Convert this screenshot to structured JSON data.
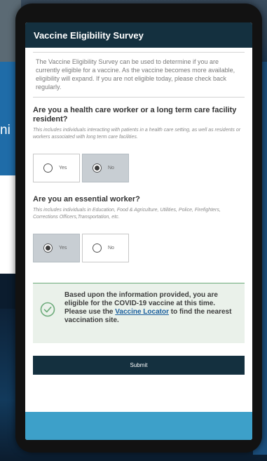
{
  "background": {
    "partial_text": "ni"
  },
  "survey": {
    "title": "Vaccine Eligibility Survey",
    "intro": "The Vaccine Eligibility Survey can be used to determine if you are currently eligible for a vaccine. As the vaccine becomes more available, eligibility will expand. If you are not eligible today, please check back regularly.",
    "q1": {
      "label": "Are you a health care worker or a long term care facility resident?",
      "hint": "This includes individuals interacting with patients in a health care setting, as well as residents or workers associated with long term care facilities.",
      "options": [
        "Yes",
        "No"
      ],
      "selected": "No"
    },
    "q2": {
      "label": "Are you an essential worker?",
      "hint": "This includes individuals in Education, Food & Agriculture, Utilities, Police, Firefighters, Corrections Officers,Transportation, etc.",
      "options": [
        "Yes",
        "No"
      ],
      "selected": "Yes"
    },
    "result": {
      "text_before": "Based upon the information provided, you are eligible for the COVID-19 vaccine at this time. Please use the ",
      "link": "Vaccine Locator",
      "text_after": " to find the nearest vaccination site.",
      "icon": "check-circle-icon",
      "accent": "#6cab7a"
    },
    "submit_label": "Submit"
  },
  "colors": {
    "header": "#14303f",
    "footer": "#3da0c9",
    "selected_option": "#c8ced3"
  }
}
